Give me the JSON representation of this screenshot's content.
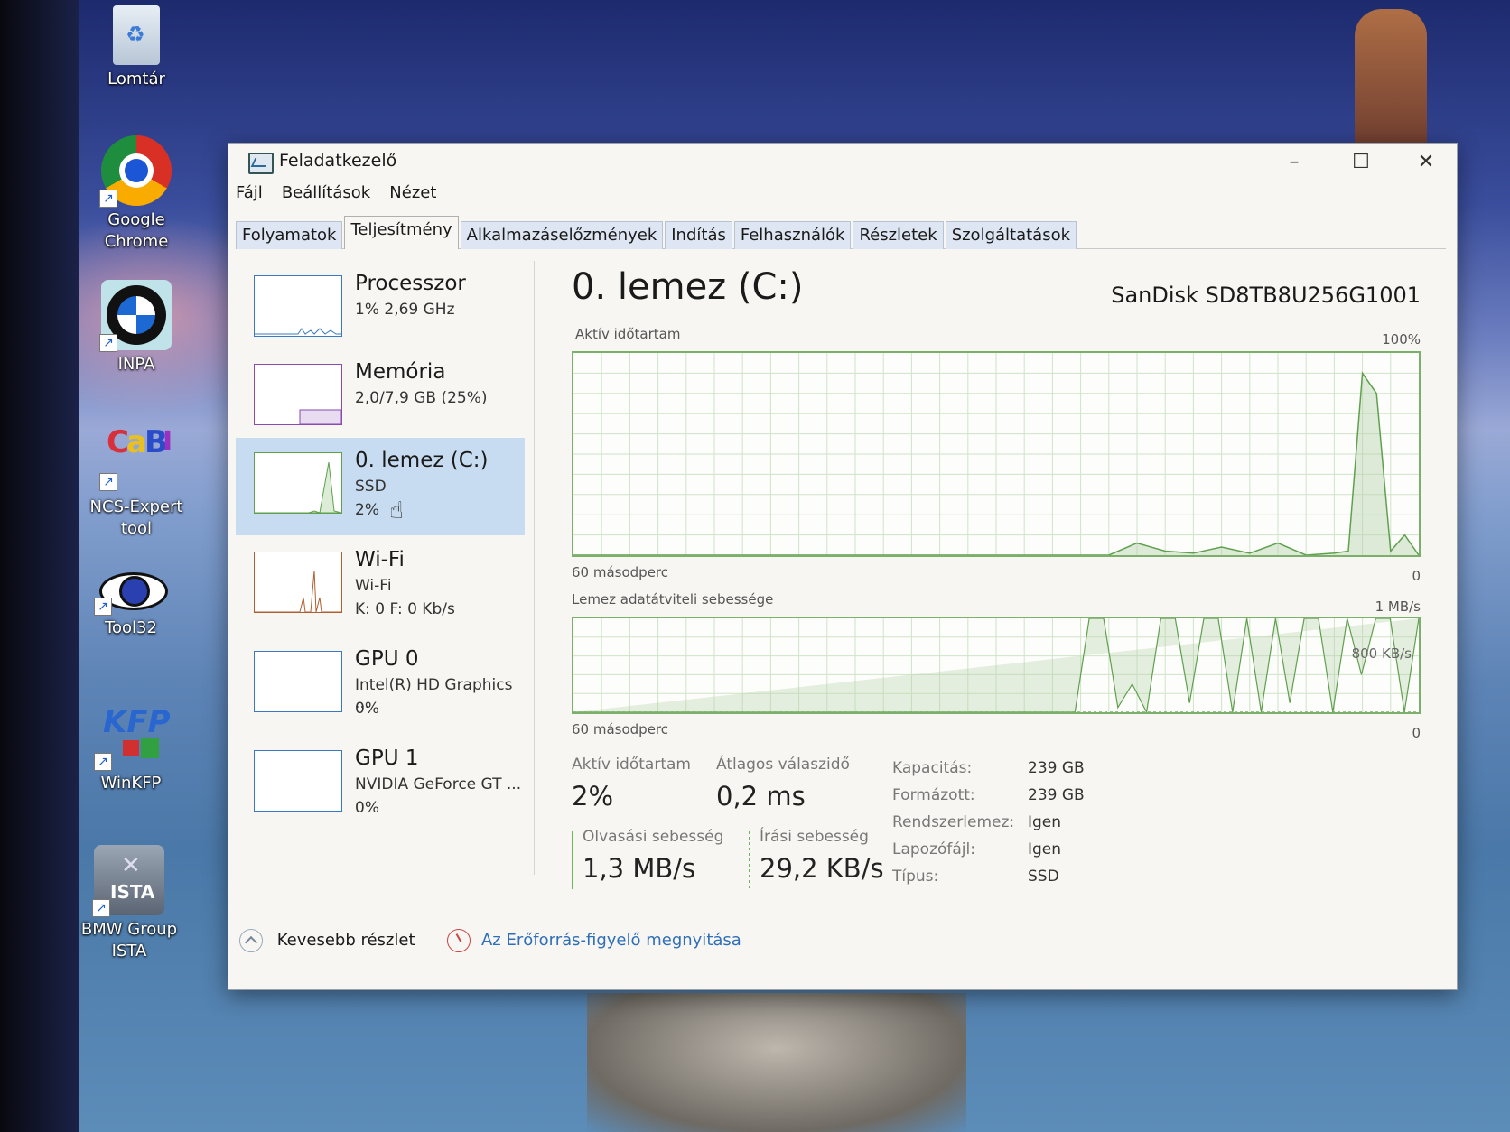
{
  "desktop": {
    "icons": [
      {
        "label": "Lomtár",
        "icon": "recycle-bin-icon"
      },
      {
        "label": "Google\nChrome",
        "icon": "chrome-icon"
      },
      {
        "label": "INPA",
        "icon": "bmw-logo-icon"
      },
      {
        "label": "NCS-Expert\ntool",
        "icon": "ncs-expert-icon"
      },
      {
        "label": "Tool32",
        "icon": "eye-icon"
      },
      {
        "label": "WinKFP",
        "icon": "winkfp-icon"
      },
      {
        "label": "BMW Group\nISTA",
        "icon": "ista-tools-icon"
      }
    ]
  },
  "window": {
    "title": "Feladatkezelő",
    "controls": {
      "minimize": "–",
      "maximize": "☐",
      "close": "✕"
    }
  },
  "menu": [
    "Fájl",
    "Beállítások",
    "Nézet"
  ],
  "tabs": [
    {
      "label": "Folyamatok",
      "active": false
    },
    {
      "label": "Teljesítmény",
      "active": true
    },
    {
      "label": "Alkalmazáselőzmények",
      "active": false
    },
    {
      "label": "Indítás",
      "active": false
    },
    {
      "label": "Felhasználók",
      "active": false
    },
    {
      "label": "Részletek",
      "active": false
    },
    {
      "label": "Szolgáltatások",
      "active": false
    }
  ],
  "sidebar": [
    {
      "title": "Processzor",
      "sub": "1%  2,69 GHz",
      "sub2": "",
      "selected": false,
      "color": "#3a78c0"
    },
    {
      "title": "Memória",
      "sub": "2,0/7,9 GB (25%)",
      "sub2": "",
      "selected": false,
      "color": "#8a4ab0"
    },
    {
      "title": "0. lemez (C:)",
      "sub": "SSD",
      "sub2": "2%",
      "selected": true,
      "color": "#5fa04e"
    },
    {
      "title": "Wi-Fi",
      "sub": "Wi-Fi",
      "sub2": "K: 0  F: 0 Kb/s",
      "selected": false,
      "color": "#b06030"
    },
    {
      "title": "GPU 0",
      "sub": "Intel(R) HD Graphics ...",
      "sub2": "0%",
      "selected": false,
      "color": "#3a78c0"
    },
    {
      "title": "GPU 1",
      "sub": "NVIDIA GeForce GT ...",
      "sub2": "0%",
      "selected": false,
      "color": "#3a78c0"
    }
  ],
  "main": {
    "title": "0. lemez (C:)",
    "model": "SanDisk SD8TB8U256G1001",
    "chart1": {
      "label": "Aktív időtartam",
      "max_label": "100%",
      "time_label": "60 másodperc",
      "min_label": "0"
    },
    "chart2": {
      "label": "Lemez adatátviteli sebessége",
      "max_label": "1 MB/s",
      "mid_label": "800 KB/s",
      "time_label": "60 másodperc",
      "min_label": "0"
    },
    "stats": {
      "active_label": "Aktív időtartam",
      "active_value": "2%",
      "response_label": "Átlagos válaszidő",
      "response_value": "0,2 ms",
      "read_label": "Olvasási sebesség",
      "read_value": "1,3 MB/s",
      "write_label": "Írási sebesség",
      "write_value": "29,2 KB/s"
    },
    "properties": [
      {
        "key": "Kapacitás:",
        "value": "239 GB"
      },
      {
        "key": "Formázott:",
        "value": "239 GB"
      },
      {
        "key": "Rendszerlemez:",
        "value": "Igen"
      },
      {
        "key": "Lapozófájl:",
        "value": "Igen"
      },
      {
        "key": "Típus:",
        "value": "SSD"
      }
    ]
  },
  "footer": {
    "fewer_details": "Kevesebb részlet",
    "resource_monitor": "Az Erőforrás-figyelő megnyitása"
  },
  "chart_data": [
    {
      "type": "area",
      "title": "Aktív időtartam",
      "x": [
        60,
        58,
        56,
        54,
        52,
        50,
        48,
        46,
        44,
        42,
        40,
        38,
        36,
        34,
        32,
        30,
        28,
        26,
        24,
        22,
        20,
        18,
        16,
        14,
        12,
        10,
        8,
        6,
        5,
        4,
        3,
        2,
        1,
        0
      ],
      "values": [
        0,
        0,
        0,
        0,
        0,
        0,
        0,
        0,
        0,
        0,
        0,
        0,
        0,
        0,
        0,
        0,
        0,
        0,
        0,
        0,
        6,
        2,
        1,
        4,
        1,
        6,
        0,
        1,
        2,
        90,
        80,
        2,
        10,
        0
      ],
      "ylim": [
        0,
        100
      ],
      "xlabel": "60 másodperc"
    },
    {
      "type": "line",
      "title": "Lemez adatátviteli sebessége",
      "series": [
        {
          "name": "Olvasási sebesség",
          "values": [
            0,
            0,
            0,
            0,
            0,
            0,
            0,
            0,
            0,
            0,
            0,
            0,
            0,
            0,
            0,
            0,
            0,
            0,
            0,
            0,
            0,
            0,
            0,
            0,
            0,
            0,
            0,
            0,
            0,
            0,
            0,
            0,
            0,
            0,
            0,
            0,
            100,
            100,
            5,
            30,
            0,
            100,
            100,
            10,
            100,
            100,
            0,
            100,
            0,
            100,
            10,
            100,
            100,
            0,
            100,
            40,
            100,
            100,
            0,
            100
          ]
        },
        {
          "name": "Írási sebesség",
          "values": [
            0,
            0,
            0,
            0,
            0,
            0,
            0,
            0,
            0,
            0,
            0,
            0,
            0,
            0,
            0,
            0,
            0,
            0,
            0,
            0,
            0,
            0,
            0,
            0,
            0,
            0,
            0,
            0,
            0,
            0,
            0,
            0,
            0,
            0,
            0,
            0,
            0,
            0,
            0,
            0,
            0,
            0,
            0,
            0,
            0,
            0,
            0,
            0,
            0,
            0,
            0,
            0,
            0,
            0,
            0,
            0,
            0,
            0,
            0,
            0
          ]
        }
      ],
      "ylim": [
        0,
        1000
      ],
      "ylabel": "KB/s",
      "xlabel": "60 másodperc"
    }
  ]
}
